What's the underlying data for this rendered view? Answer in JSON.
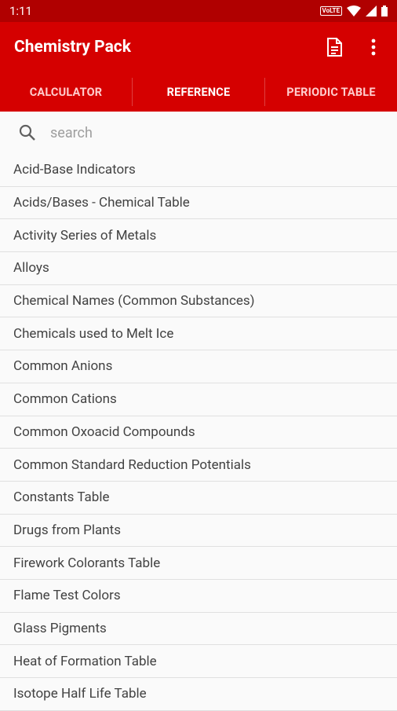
{
  "status_bar": {
    "time": "1:11",
    "volte": "VoLTE"
  },
  "app_bar": {
    "title": "Chemistry Pack"
  },
  "tabs": [
    {
      "label": "CALCULATOR"
    },
    {
      "label": "REFERENCE"
    },
    {
      "label": "PERIODIC TABLE"
    }
  ],
  "search": {
    "placeholder": "search",
    "value": ""
  },
  "reference_items": [
    "Acid-Base Indicators",
    "Acids/Bases - Chemical Table",
    "Activity Series of Metals",
    "Alloys",
    "Chemical Names (Common Substances)",
    "Chemicals used to Melt Ice",
    "Common Anions",
    "Common Cations",
    "Common Oxoacid Compounds",
    "Common Standard Reduction Potentials",
    "Constants Table",
    "Drugs from Plants",
    "Firework Colorants Table",
    "Flame Test Colors",
    "Glass Pigments",
    "Heat of Formation Table",
    "Isotope Half Life Table"
  ],
  "colors": {
    "primary": "#d50000",
    "status_bar": "#b00000"
  }
}
